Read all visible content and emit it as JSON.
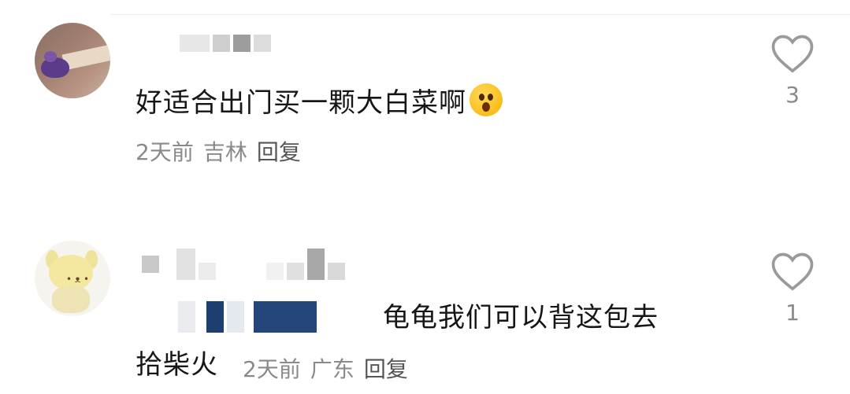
{
  "comments": [
    {
      "text": "好适合出门买一颗大白菜啊",
      "time": "2天前",
      "location": "吉林",
      "reply_label": "回复",
      "likes": "3",
      "emoji": "astonished-face"
    },
    {
      "text_line1": "龟龟我们可以背这包去",
      "text_line2": "拾柴火",
      "time": "2天前",
      "location": "广东",
      "reply_label": "回复",
      "likes": "1"
    }
  ],
  "colors": {
    "meta": "#8a8a8a",
    "heart": "#9a9a9a",
    "text": "#161616"
  }
}
